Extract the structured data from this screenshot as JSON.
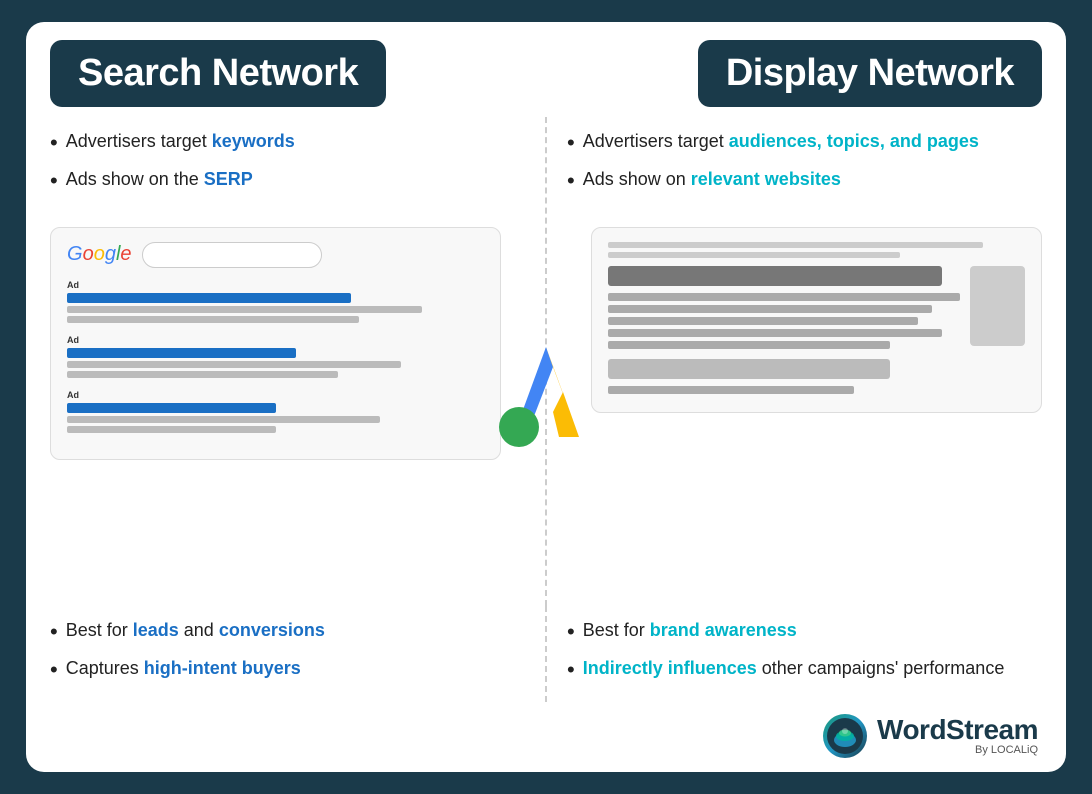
{
  "header": {
    "search_network_label": "Search Network",
    "display_network_label": "Display Network"
  },
  "search_network": {
    "bullets": [
      {
        "prefix": "Advertisers target ",
        "highlight": "keywords",
        "suffix": ""
      },
      {
        "prefix": "Ads show on the ",
        "highlight": "SERP",
        "suffix": ""
      }
    ],
    "bottom_bullets": [
      {
        "prefix": "Best for ",
        "highlight": "leads",
        "mid": " and ",
        "highlight2": "conversions",
        "suffix": ""
      },
      {
        "prefix": "Captures ",
        "highlight": "high-intent buyers",
        "suffix": ""
      }
    ]
  },
  "display_network": {
    "bullets": [
      {
        "prefix": "Advertisers target ",
        "highlight": "audiences, topics, and pages",
        "suffix": ""
      },
      {
        "prefix": "Ads show on ",
        "highlight": "relevant websites",
        "suffix": ""
      }
    ],
    "bottom_bullets": [
      {
        "prefix": "Best for ",
        "highlight": "brand awareness",
        "suffix": ""
      },
      {
        "prefix_highlight": "Indirectly influences",
        "suffix": " other campaigns' performance"
      }
    ]
  },
  "footer": {
    "brand_name": "WordStream",
    "by_text": "By LOCALiQ"
  }
}
